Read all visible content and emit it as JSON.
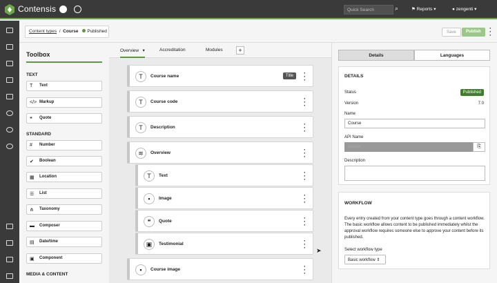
{
  "app": {
    "brand": "Contensis",
    "search_placeholder": "Quick Search",
    "reports": "Reports",
    "user": "zengenti"
  },
  "breadcrumb": {
    "link": "Content types",
    "current": "Course",
    "status": "Published"
  },
  "actions": {
    "save": "Save",
    "publish": "Publish"
  },
  "toolbox": {
    "title": "Toolbox",
    "text_section": "TEXT",
    "text_items": [
      "Text",
      "Markup",
      "Quote"
    ],
    "standard_section": "STANDARD",
    "standard_items": [
      "Number",
      "Boolean",
      "Location",
      "List",
      "Taxonomy",
      "Composer",
      "Date/time",
      "Component"
    ],
    "media_section": "MEDIA & CONTENT"
  },
  "tabs": [
    "Overview",
    "Accreditation",
    "Modules"
  ],
  "fields": {
    "course_name": "Course name",
    "title_badge": "Title",
    "course_code": "Course code",
    "description": "Description",
    "overview": "Overview",
    "sub": [
      "Text",
      "Image",
      "Quote",
      "Testimonial"
    ],
    "course_image": "Course image"
  },
  "panel": {
    "tab_details": "Details",
    "tab_languages": "Languages",
    "details_title": "DETAILS",
    "status_label": "Status",
    "status_value": "Published",
    "version_label": "Version",
    "version_value": "7.0",
    "name_label": "Name",
    "name_value": "Course",
    "api_label": "API Name",
    "api_value": "course",
    "desc_label": "Description",
    "workflow_title": "WORKFLOW",
    "workflow_text": "Every entry created from your content type goes through a content workflow. The basic workflow allows content to be published immediately whilst the approval workflow requires someone else to approve your content before its published.",
    "select_label": "Select workflow type",
    "select_value": "Basic workflow"
  },
  "colors": {
    "accent": "#5a9a3a",
    "topbar": "#3a3a3a"
  }
}
